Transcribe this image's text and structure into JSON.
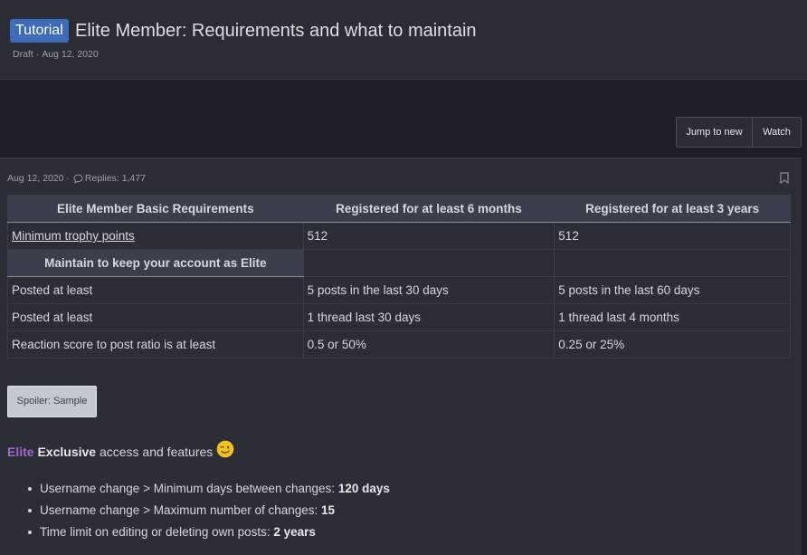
{
  "thread": {
    "prefix": "Tutorial",
    "title": "Elite Member: Requirements and what to maintain",
    "status": "Draft",
    "date": "Aug 12, 2020"
  },
  "actions": {
    "jump_to_new": "Jump to new",
    "watch": "Watch"
  },
  "post": {
    "date": "Aug 12, 2020",
    "replies": "Replies: 1,477"
  },
  "table": {
    "headers": [
      "Elite Member Basic Requirements",
      "Registered for at least 6 months",
      "Registered for at least 3 years"
    ],
    "trophy_row": [
      "Minimum trophy points",
      "512",
      "512"
    ],
    "maintain_header": "Maintain to keep your account as Elite",
    "rows": [
      [
        "Posted at least",
        "5 posts in the last 30 days",
        "5 posts in the last 60 days"
      ],
      [
        "Posted at least",
        "1 thread last 30 days",
        "1 thread last 4 months"
      ],
      [
        "Reaction score to post ratio is at least",
        "0.5 or 50%",
        "0.25 or 25%"
      ]
    ]
  },
  "spoiler": {
    "label": "Spoiler: Sample"
  },
  "features": {
    "elite": "Elite",
    "exclusive": "Exclusive",
    "rest": "access and features",
    "emoji": "winking-face",
    "items": [
      {
        "text": "Username change > Minimum days between changes: ",
        "value": "120 days"
      },
      {
        "text": "Username change > Maximum number of changes: ",
        "value": "15"
      },
      {
        "text": "Time limit on editing or deleting own posts: ",
        "value": "2 years"
      }
    ]
  },
  "colors": {
    "prefix_bg": "#3d6bb8",
    "elite": "#a066cf",
    "page_bg": "#1d1f26",
    "panel_bg": "#2b2e36"
  }
}
